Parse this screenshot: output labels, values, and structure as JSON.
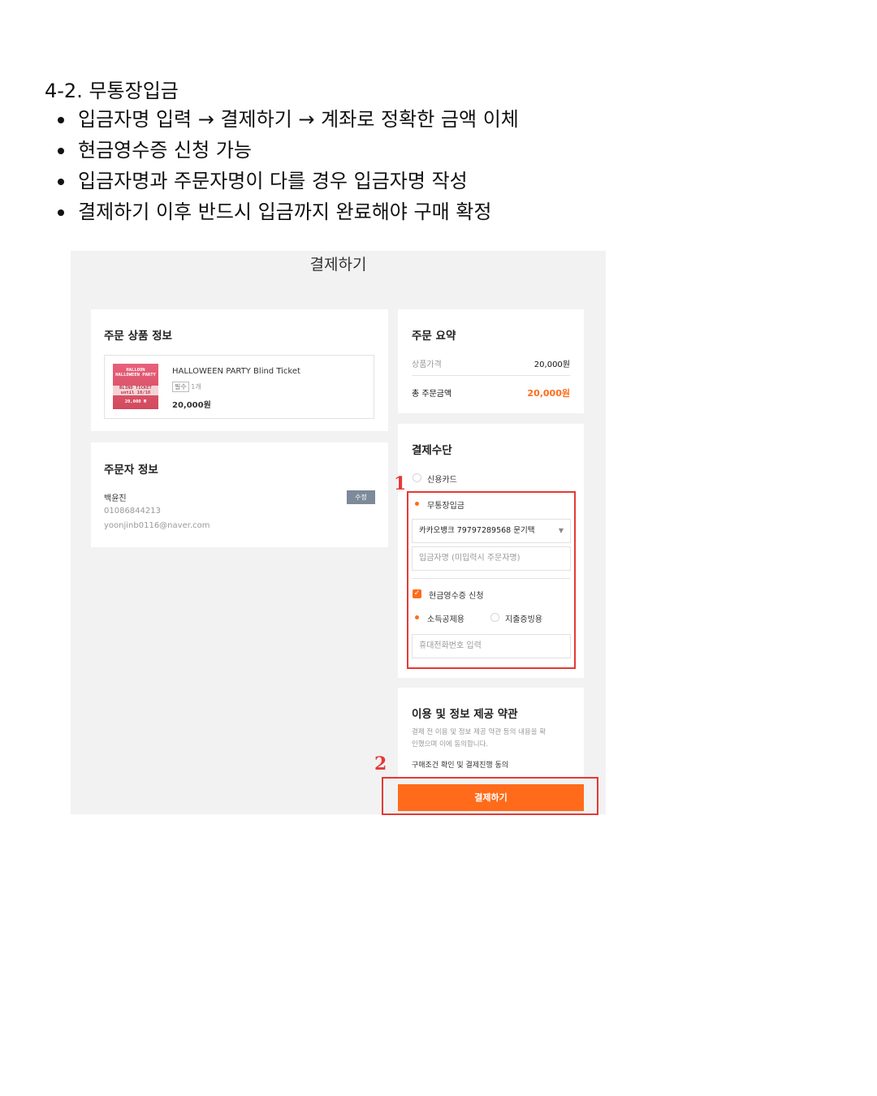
{
  "doc": {
    "title": "4-2. 무통장입금",
    "bullets": [
      "입금자명 입력 → 결제하기 → 계좌로 정확한 금액 이체",
      "현금영수증 신청 가능",
      "입금자명과 주문자명이 다를 경우 입금자명 작성",
      "결제하기 이후 반드시 입금까지 완료해야 구매 확정"
    ]
  },
  "screen": {
    "title": "결제하기",
    "order_product": {
      "heading": "주문 상품 정보",
      "thumb_lines": [
        "HALLOON",
        "HALLOWEEN PARTY",
        "BLIND TICKET",
        "until 10/10",
        "20,000 ₩"
      ],
      "name": "HALLOWEEN PARTY Blind Ticket",
      "badge": "필수",
      "qty": "1개",
      "price": "20,000원"
    },
    "orderer": {
      "heading": "주문자 정보",
      "name": "백윤진",
      "phone": "01086844213",
      "email": "yoonjinb0116@naver.com",
      "edit_label": "수정"
    },
    "summary": {
      "heading": "주문 요약",
      "product_price_label": "상품가격",
      "product_price_value": "20,000원",
      "total_label": "총 주문금액",
      "total_value": "20,000원"
    },
    "payment": {
      "heading": "결제수단",
      "credit_card": "신용카드",
      "bank_transfer": "무통장입금",
      "account_select": "카카오뱅크 79797289568 문기택",
      "depositor_placeholder": "입금자명 (미입력시 주문자명)",
      "receipt_label": "현금영수증 신청",
      "income_deduction": "소득공제용",
      "expense_proof": "지출증빙용",
      "phone_placeholder": "휴대전화번호 입력"
    },
    "terms": {
      "heading": "이용 및 정보 제공 약관",
      "text_line1": "결제 전 이용 및 정보 제공 약관 등의 내용을 확",
      "text_line2": "인했으며 이에 동의합니다.",
      "agree": "구매조건 확인 및 결제진행 동의"
    },
    "pay_button": "결제하기",
    "markers": [
      "1",
      "2"
    ]
  },
  "colors": {
    "accent": "#ff6b1a",
    "annotation_red": "#e53935",
    "screen_bg": "#f2f2f2",
    "edit_button": "#7c8a99"
  }
}
